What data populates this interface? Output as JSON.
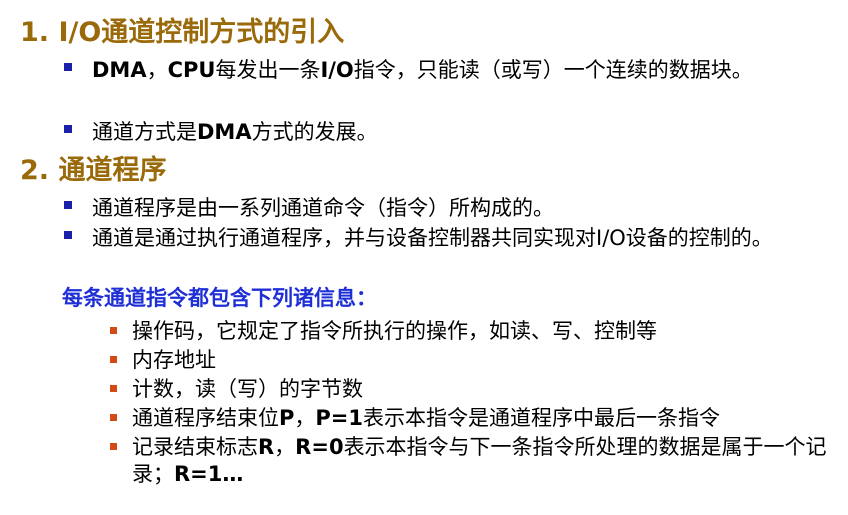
{
  "heading1": "1. I/O通道控制方式的引入",
  "bullets1": [
    {
      "parts": [
        {
          "text": "DMA",
          "bold": true
        },
        {
          "text": "，",
          "bold": false
        },
        {
          "text": "CPU",
          "bold": true
        },
        {
          "text": "每发出一条",
          "bold": false
        },
        {
          "text": "I/O",
          "bold": true
        },
        {
          "text": "指令，只能读（或写）一个连续的数据块。",
          "bold": false
        }
      ]
    },
    {
      "parts": [
        {
          "text": "通道方式是",
          "bold": false
        },
        {
          "text": "DMA",
          "bold": true
        },
        {
          "text": "方式的发展。",
          "bold": false
        }
      ]
    }
  ],
  "heading2": "2. 通道程序",
  "bullets2": [
    "通道程序是由一系列通道命令（指令）所构成的。",
    "通道是通过执行通道程序，并与设备控制器共同实现对I/O设备的控制的。"
  ],
  "subheading": "每条通道指令都包含下列诸信息：",
  "sub_bullets": [
    {
      "parts": [
        {
          "text": "操作码，它规定了指令所执行的操作，如读、写、控制等",
          "bold": false
        }
      ]
    },
    {
      "parts": [
        {
          "text": "内存地址",
          "bold": false
        }
      ]
    },
    {
      "parts": [
        {
          "text": "计数，读（写）的字节数",
          "bold": false
        }
      ]
    },
    {
      "parts": [
        {
          "text": "通道程序结束位",
          "bold": false
        },
        {
          "text": "P",
          "bold": true
        },
        {
          "text": "，",
          "bold": false
        },
        {
          "text": "P=1",
          "bold": true
        },
        {
          "text": "表示本指令是通道程序中最后一条指令",
          "bold": false
        }
      ]
    },
    {
      "parts": [
        {
          "text": "记录结束标志",
          "bold": false
        },
        {
          "text": "R",
          "bold": true
        },
        {
          "text": "，",
          "bold": false
        },
        {
          "text": "R=0",
          "bold": true
        },
        {
          "text": "表示本指令与下一条指令所处理的数据是属于一个记录；",
          "bold": false
        },
        {
          "text": "R=1…",
          "bold": true
        }
      ]
    }
  ],
  "colors": {
    "heading": "#9a6a0a",
    "subheading": "#1f2fd6",
    "bullet_level1": "#1c1fa8",
    "bullet_level2": "#d34a14"
  }
}
